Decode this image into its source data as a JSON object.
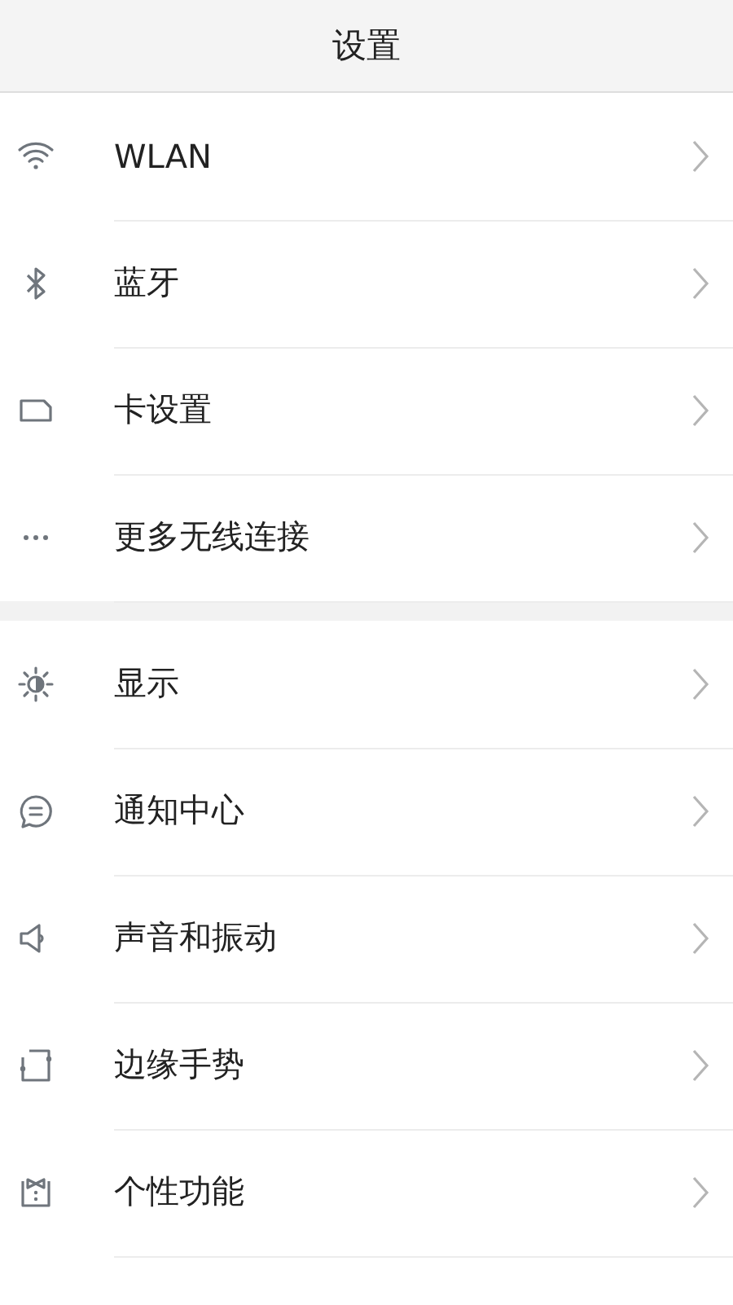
{
  "header": {
    "title": "设置"
  },
  "groups": [
    {
      "items": [
        {
          "label": "WLAN"
        },
        {
          "label": "蓝牙"
        },
        {
          "label": "卡设置"
        },
        {
          "label": "更多无线连接"
        }
      ]
    },
    {
      "items": [
        {
          "label": "显示"
        },
        {
          "label": "通知中心"
        },
        {
          "label": "声音和振动"
        },
        {
          "label": "边缘手势"
        },
        {
          "label": "个性功能"
        }
      ]
    }
  ]
}
